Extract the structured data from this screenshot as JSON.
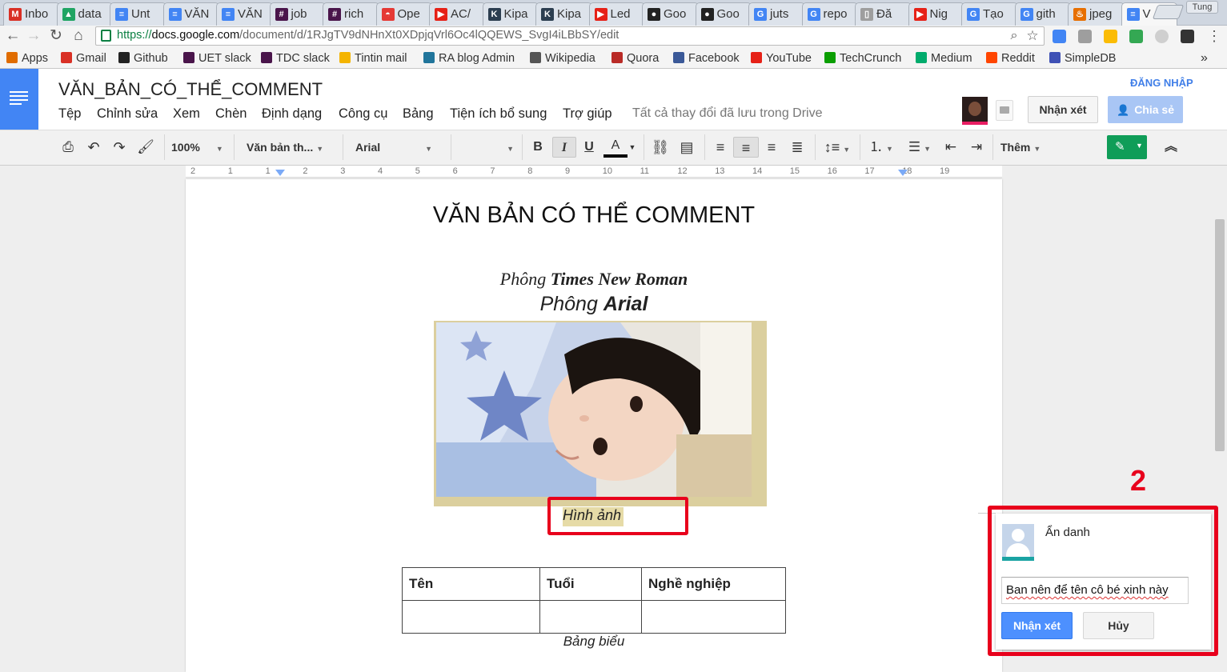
{
  "browser": {
    "tabs": [
      {
        "label": "Inbo",
        "icon": "gmail-icon",
        "color": "#d93025",
        "glyph": "M"
      },
      {
        "label": "data",
        "icon": "drive-icon",
        "color": "#1fa463",
        "glyph": "▲"
      },
      {
        "label": "Unt",
        "icon": "docs-icon",
        "color": "#4285f4",
        "glyph": "≡"
      },
      {
        "label": "VĂN",
        "icon": "docs-icon",
        "color": "#4285f4",
        "glyph": "≡"
      },
      {
        "label": "VĂN",
        "icon": "docs-icon",
        "color": "#4285f4",
        "glyph": "≡"
      },
      {
        "label": "job",
        "icon": "slack-icon",
        "color": "#4a154b",
        "glyph": "#"
      },
      {
        "label": "rich",
        "icon": "slack-icon",
        "color": "#4a154b",
        "glyph": "#"
      },
      {
        "label": "Ope",
        "icon": "pokeball-icon",
        "color": "#e53935",
        "glyph": "◓"
      },
      {
        "label": "AC/",
        "icon": "youtube-icon",
        "color": "#e62117",
        "glyph": "▶"
      },
      {
        "label": "Kipa",
        "icon": "kipalog-icon",
        "color": "#2c3e50",
        "glyph": "K"
      },
      {
        "label": "Kipa",
        "icon": "kipalog-icon",
        "color": "#2c3e50",
        "glyph": "K"
      },
      {
        "label": "Led",
        "icon": "youtube-icon",
        "color": "#e62117",
        "glyph": "▶"
      },
      {
        "label": "Goo",
        "icon": "github-icon",
        "color": "#222222",
        "glyph": "●"
      },
      {
        "label": "Goo",
        "icon": "github-icon",
        "color": "#222222",
        "glyph": "●"
      },
      {
        "label": "juts",
        "icon": "google-icon",
        "color": "#4285f4",
        "glyph": "G"
      },
      {
        "label": "repo",
        "icon": "google-icon",
        "color": "#4285f4",
        "glyph": "G"
      },
      {
        "label": "Đă",
        "icon": "page-icon",
        "color": "#9e9e9e",
        "glyph": "▯"
      },
      {
        "label": "Nig",
        "icon": "youtube-icon",
        "color": "#e62117",
        "glyph": "▶"
      },
      {
        "label": "Tạo",
        "icon": "google-icon",
        "color": "#4285f4",
        "glyph": "G"
      },
      {
        "label": "gith",
        "icon": "google-icon",
        "color": "#4285f4",
        "glyph": "G"
      },
      {
        "label": "jpeg",
        "icon": "java-icon",
        "color": "#e76f00",
        "glyph": "♨"
      },
      {
        "label": "V",
        "icon": "docs-icon",
        "color": "#4285f4",
        "glyph": "≡",
        "active": true
      }
    ],
    "profile_name": "Tung",
    "url_protocol": "https://",
    "url_host": "docs.google.com",
    "url_path": "/document/d/1RJgTV9dNHnXt0XDpjqVrl6Oc4lQQEWS_SvgI4iLBbSY/edit"
  },
  "bookmarks": [
    {
      "label": "Apps",
      "icon": "apps-grid-icon",
      "color": "#e06c00"
    },
    {
      "label": "Gmail",
      "icon": "gmail-icon",
      "color": "#d93025"
    },
    {
      "label": "Github",
      "icon": "github-icon",
      "color": "#222222"
    },
    {
      "label": "UET slack",
      "icon": "slack-icon",
      "color": "#4a154b"
    },
    {
      "label": "TDC slack",
      "icon": "slack-icon",
      "color": "#4a154b"
    },
    {
      "label": "Tintin mail",
      "icon": "mail-envelope-icon",
      "color": "#f4b400"
    },
    {
      "label": "RA blog Admin",
      "icon": "wordpress-icon",
      "color": "#21759b"
    },
    {
      "label": "Wikipedia",
      "icon": "wikipedia-icon",
      "color": "#555555"
    },
    {
      "label": "Quora",
      "icon": "quora-icon",
      "color": "#b92b27"
    },
    {
      "label": "Facebook",
      "icon": "facebook-icon",
      "color": "#3b5998"
    },
    {
      "label": "YouTube",
      "icon": "youtube-icon",
      "color": "#e62117"
    },
    {
      "label": "TechCrunch",
      "icon": "techcrunch-icon",
      "color": "#0a9e01"
    },
    {
      "label": "Medium",
      "icon": "medium-icon",
      "color": "#00ab6c"
    },
    {
      "label": "Reddit",
      "icon": "reddit-icon",
      "color": "#ff4500"
    },
    {
      "label": "SimpleDB",
      "icon": "simpledb-icon",
      "color": "#3f51b5"
    }
  ],
  "docs": {
    "title": "VĂN_BẢN_CÓ_THỂ_COMMENT",
    "menus": [
      "Tệp",
      "Chỉnh sửa",
      "Xem",
      "Chèn",
      "Định dạng",
      "Công cụ",
      "Bảng",
      "Tiện ích bổ sung",
      "Trợ giúp"
    ],
    "save_status": "Tất cả thay đổi đã lưu trong Drive",
    "signin_label": "ĐĂNG NHẬP",
    "comment_button": "Nhận xét",
    "share_button": "Chia sẻ",
    "brand_color": "#4285f4"
  },
  "format_toolbar": {
    "zoom": "100%",
    "style": "Văn bản th...",
    "font": "Arial",
    "font_size": "",
    "more_label": "Thêm",
    "bold_glyph": "B",
    "italic_glyph": "I",
    "underline_glyph": "U",
    "color_glyph": "A"
  },
  "ruler_ticks": [
    "2",
    "1",
    "1",
    "2",
    "3",
    "4",
    "5",
    "6",
    "7",
    "8",
    "9",
    "10",
    "11",
    "12",
    "13",
    "14",
    "15",
    "16",
    "17",
    "18",
    "19"
  ],
  "document": {
    "heading": "VĂN BẢN CÓ THỂ COMMENT",
    "tnr_prefix": "Phông ",
    "tnr_name": "Times New Roman",
    "arial_prefix": "Phông ",
    "arial_name": "Arial",
    "image_caption": "Hình ảnh",
    "table_headers": [
      "Tên",
      "Tuổi",
      "Nghề nghiệp"
    ],
    "table_row": [
      "",
      "",
      ""
    ],
    "table_caption": "Bảng biểu"
  },
  "comment_panel": {
    "step_number": "2",
    "author": "Ẩn danh",
    "comment_text": "Ban nên để tên cô bé xinh này",
    "submit_label": "Nhận xét",
    "cancel_label": "Hủy",
    "highlight_color": "#e8001c"
  }
}
